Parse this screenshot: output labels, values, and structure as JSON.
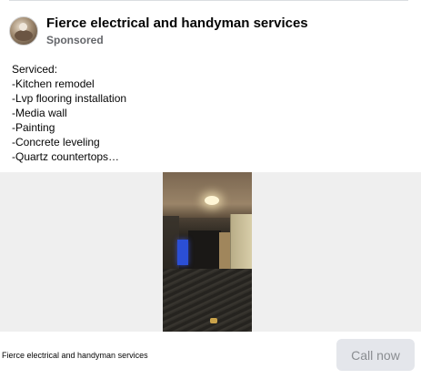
{
  "post": {
    "page_name": "Fierce electrical and handyman services",
    "sponsored_label": "Sponsored",
    "body_lines": [
      "Serviced:",
      "-Kitchen remodel",
      "-Lvp flooring installation",
      "-Media wall",
      "-Painting",
      "-Concrete leveling",
      "-Quartz countertops…"
    ]
  },
  "footer": {
    "advertiser_name": "Fierce electrical and handyman services",
    "cta_label": "Call now"
  },
  "colors": {
    "cta_background": "#e4e6eb",
    "cta_text": "#8a8d91",
    "secondary_text": "#65676b"
  }
}
